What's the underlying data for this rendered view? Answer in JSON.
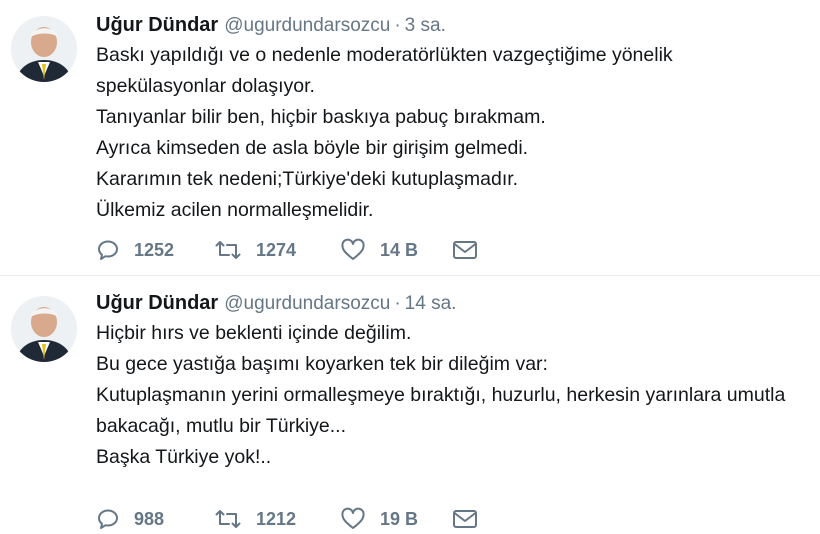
{
  "tweets": [
    {
      "author_name": "Uğur Dündar",
      "handle": "@ugurdundarsozcu",
      "separator": "·",
      "time": "3 sa.",
      "lines": [
        "Baskı yapıldığı ve o nedenle moderatörlükten vazgeçtiğime yönelik",
        "spekülasyonlar dolaşıyor.",
        "Tanıyanlar bilir ben, hiçbir baskıya pabuç bırakmam.",
        "Ayrıca kimseden de asla böyle bir girişim gelmedi.",
        "Kararımın tek nedeni;Türkiye'deki kutuplaşmadır.",
        "Ülkemiz acilen normalleşmelidir."
      ],
      "replies": "1252",
      "retweets": "1274",
      "likes": "14 B",
      "icons": {
        "reply": "reply-icon",
        "retweet": "retweet-icon",
        "like": "heart-icon",
        "dm": "envelope-icon"
      }
    },
    {
      "author_name": "Uğur Dündar",
      "handle": "@ugurdundarsozcu",
      "separator": "·",
      "time": "14 sa.",
      "lines": [
        "Hiçbir hırs ve beklenti içinde değilim.",
        "Bu gece yastığa başımı koyarken tek bir dileğim var:",
        "Kutuplaşmanın yerini ormalleşmeye bıraktığı, huzurlu, herkesin yarınlara umutla",
        "bakacağı, mutlu bir Türkiye...",
        "Başka Türkiye yok!.."
      ],
      "replies": "988",
      "retweets": "1212",
      "likes": "19 B",
      "icons": {
        "reply": "reply-icon",
        "retweet": "retweet-icon",
        "like": "heart-icon",
        "dm": "envelope-icon"
      }
    }
  ],
  "colors": {
    "text": "#14171a",
    "secondary": "#657786",
    "divider": "#e6ecf0"
  }
}
